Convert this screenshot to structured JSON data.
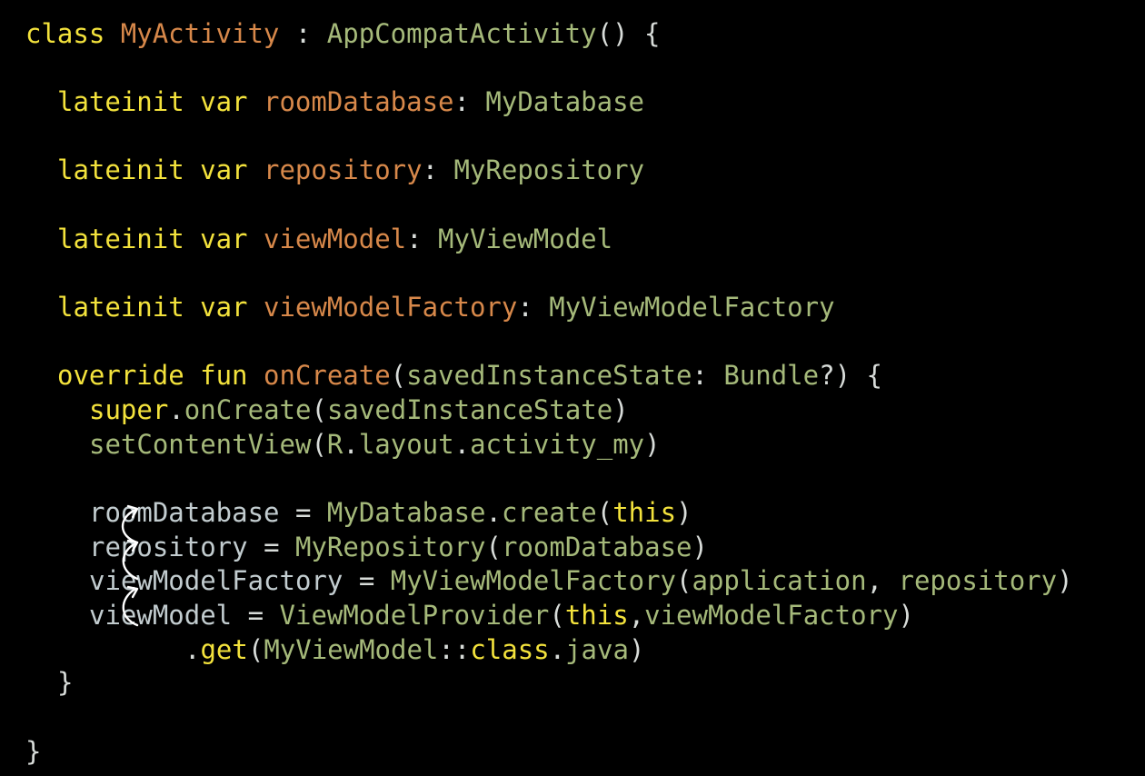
{
  "colors": {
    "background": "#000000",
    "keyword": "#f3e23c",
    "identifier": "#d7884a",
    "type": "#a5b97a",
    "plain": "#c2cccf",
    "punct": "#d8dcd9",
    "arrow": "#ffffff"
  },
  "code": {
    "lines": [
      {
        "indent": 0,
        "tokens": [
          {
            "t": "class",
            "k": "keyword"
          },
          {
            "t": " ",
            "k": "plain"
          },
          {
            "t": "MyActivity",
            "k": "identifier"
          },
          {
            "t": " : ",
            "k": "punct"
          },
          {
            "t": "AppCompatActivity",
            "k": "type"
          },
          {
            "t": "() {",
            "k": "punct"
          }
        ]
      },
      {
        "indent": 1,
        "tokens": [
          {
            "t": "lateinit var",
            "k": "keyword"
          },
          {
            "t": " ",
            "k": "plain"
          },
          {
            "t": "roomDatabase",
            "k": "identifier"
          },
          {
            "t": ": ",
            "k": "punct"
          },
          {
            "t": "MyDatabase",
            "k": "type"
          }
        ]
      },
      {
        "indent": 1,
        "tokens": [
          {
            "t": "lateinit var",
            "k": "keyword"
          },
          {
            "t": " ",
            "k": "plain"
          },
          {
            "t": "repository",
            "k": "identifier"
          },
          {
            "t": ": ",
            "k": "punct"
          },
          {
            "t": "MyRepository",
            "k": "type"
          }
        ]
      },
      {
        "indent": 1,
        "tokens": [
          {
            "t": "lateinit var",
            "k": "keyword"
          },
          {
            "t": " ",
            "k": "plain"
          },
          {
            "t": "viewModel",
            "k": "identifier"
          },
          {
            "t": ": ",
            "k": "punct"
          },
          {
            "t": "MyViewModel",
            "k": "type"
          }
        ]
      },
      {
        "indent": 1,
        "tokens": [
          {
            "t": "lateinit var",
            "k": "keyword"
          },
          {
            "t": " ",
            "k": "plain"
          },
          {
            "t": "viewModelFactory",
            "k": "identifier"
          },
          {
            "t": ": ",
            "k": "punct"
          },
          {
            "t": "MyViewModelFactory",
            "k": "type"
          }
        ]
      },
      {
        "indent": 1,
        "tokens": [
          {
            "t": "override fun",
            "k": "keyword"
          },
          {
            "t": " ",
            "k": "plain"
          },
          {
            "t": "onCreate",
            "k": "identifier"
          },
          {
            "t": "(",
            "k": "punct"
          },
          {
            "t": "savedInstanceState",
            "k": "type"
          },
          {
            "t": ": ",
            "k": "punct"
          },
          {
            "t": "Bundle",
            "k": "type"
          },
          {
            "t": "?) {",
            "k": "punct"
          }
        ]
      },
      {
        "indent": 2,
        "tokens": [
          {
            "t": "super",
            "k": "keyword"
          },
          {
            "t": ".",
            "k": "punct"
          },
          {
            "t": "onCreate",
            "k": "type"
          },
          {
            "t": "(",
            "k": "punct"
          },
          {
            "t": "savedInstanceState",
            "k": "type"
          },
          {
            "t": ")",
            "k": "punct"
          }
        ]
      },
      {
        "indent": 2,
        "tokens": [
          {
            "t": "setContentView",
            "k": "type"
          },
          {
            "t": "(",
            "k": "punct"
          },
          {
            "t": "R",
            "k": "type"
          },
          {
            "t": ".",
            "k": "punct"
          },
          {
            "t": "layout",
            "k": "type"
          },
          {
            "t": ".",
            "k": "punct"
          },
          {
            "t": "activity_my",
            "k": "type"
          },
          {
            "t": ")",
            "k": "punct"
          }
        ]
      },
      {
        "indent": 2,
        "tokens": [
          {
            "t": "roomDatabase",
            "k": "plain"
          },
          {
            "t": " = ",
            "k": "punct"
          },
          {
            "t": "MyDatabase",
            "k": "type"
          },
          {
            "t": ".",
            "k": "punct"
          },
          {
            "t": "create",
            "k": "type"
          },
          {
            "t": "(",
            "k": "punct"
          },
          {
            "t": "this",
            "k": "keyword"
          },
          {
            "t": ")",
            "k": "punct"
          }
        ]
      },
      {
        "indent": 2,
        "tokens": [
          {
            "t": "repository",
            "k": "plain"
          },
          {
            "t": " = ",
            "k": "punct"
          },
          {
            "t": "MyRepository",
            "k": "type"
          },
          {
            "t": "(",
            "k": "punct"
          },
          {
            "t": "roomDatabase",
            "k": "type"
          },
          {
            "t": ")",
            "k": "punct"
          }
        ]
      },
      {
        "indent": 2,
        "tokens": [
          {
            "t": "viewModelFactory",
            "k": "plain"
          },
          {
            "t": " = ",
            "k": "punct"
          },
          {
            "t": "MyViewModelFactory",
            "k": "type"
          },
          {
            "t": "(",
            "k": "punct"
          },
          {
            "t": "application",
            "k": "type"
          },
          {
            "t": ", ",
            "k": "punct"
          },
          {
            "t": "repository",
            "k": "type"
          },
          {
            "t": ")",
            "k": "punct"
          }
        ]
      },
      {
        "indent": 2,
        "tokens": [
          {
            "t": "viewModel",
            "k": "plain"
          },
          {
            "t": " = ",
            "k": "punct"
          },
          {
            "t": "ViewModelProvider",
            "k": "type"
          },
          {
            "t": "(",
            "k": "punct"
          },
          {
            "t": "this",
            "k": "keyword"
          },
          {
            "t": ",",
            "k": "punct"
          },
          {
            "t": "viewModelFactory",
            "k": "type"
          },
          {
            "t": ")",
            "k": "punct"
          }
        ]
      },
      {
        "indent": 5,
        "tokens": [
          {
            "t": ".",
            "k": "punct"
          },
          {
            "t": "get",
            "k": "keyword"
          },
          {
            "t": "(",
            "k": "punct"
          },
          {
            "t": "MyViewModel",
            "k": "type"
          },
          {
            "t": "::",
            "k": "punct"
          },
          {
            "t": "class",
            "k": "keyword"
          },
          {
            "t": ".",
            "k": "punct"
          },
          {
            "t": "java",
            "k": "type"
          },
          {
            "t": ")",
            "k": "punct"
          }
        ]
      },
      {
        "indent": 1,
        "tokens": [
          {
            "t": "}",
            "k": "punct"
          }
        ]
      },
      {
        "indent": 0,
        "tokens": [
          {
            "t": "}",
            "k": "punct"
          }
        ]
      }
    ]
  },
  "annotations": {
    "arrow_icon": "curved-arrow-icon"
  }
}
